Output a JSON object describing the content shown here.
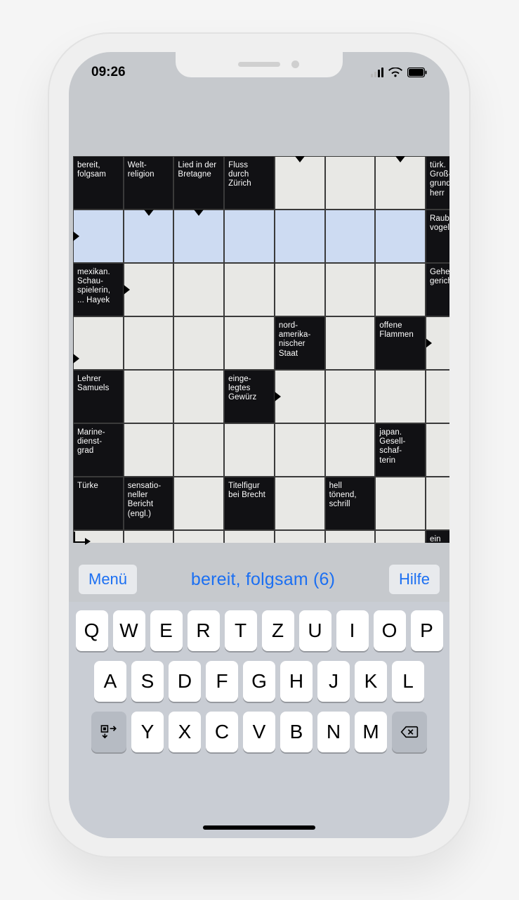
{
  "status": {
    "time": "09:26"
  },
  "cluebar": {
    "menu_label": "Menü",
    "help_label": "Hilfe",
    "current_clue": "bereit, folgsam (6)"
  },
  "grid": {
    "rows": [
      [
        {
          "t": "dark",
          "clue": "bereit, folgsam"
        },
        {
          "t": "dark",
          "clue": "Welt-\nreligion"
        },
        {
          "t": "dark",
          "clue": "Lied in der Bretagne"
        },
        {
          "t": "dark",
          "clue": "Fluss durch Zürich"
        },
        {
          "t": "light",
          "arrows": [
            "down"
          ]
        },
        {
          "t": "light"
        },
        {
          "t": "light",
          "arrows": [
            "down"
          ]
        },
        {
          "t": "dark",
          "clue": "türk. Groß-\ngrund-\nherr",
          "partial": true
        }
      ],
      [
        {
          "t": "hi",
          "arrows": [
            "right"
          ]
        },
        {
          "t": "hi",
          "arrows": [
            "down"
          ]
        },
        {
          "t": "hi",
          "arrows": [
            "down"
          ]
        },
        {
          "t": "hi"
        },
        {
          "t": "hi"
        },
        {
          "t": "hi"
        },
        {
          "t": "hi"
        },
        {
          "t": "dark",
          "clue": "Raub-\nvogel",
          "partial": true
        }
      ],
      [
        {
          "t": "dark",
          "clue": "mexikan. Schau-\nspielerin, ... Hayek"
        },
        {
          "t": "light",
          "arrows": [
            "right"
          ]
        },
        {
          "t": "light"
        },
        {
          "t": "light"
        },
        {
          "t": "light"
        },
        {
          "t": "light"
        },
        {
          "t": "light"
        },
        {
          "t": "dark",
          "clue": "Geheim-\ngericht",
          "partial": true
        }
      ],
      [
        {
          "t": "light",
          "arrows": [
            "right-low"
          ]
        },
        {
          "t": "light"
        },
        {
          "t": "light"
        },
        {
          "t": "light"
        },
        {
          "t": "dark",
          "clue": "nord-\namerika-\nnischer Staat"
        },
        {
          "t": "light"
        },
        {
          "t": "dark",
          "clue": "offene Flammen"
        },
        {
          "t": "light",
          "arrows": [
            "right"
          ],
          "partial": true
        }
      ],
      [
        {
          "t": "dark",
          "clue": "Lehrer Samuels"
        },
        {
          "t": "light"
        },
        {
          "t": "light"
        },
        {
          "t": "dark",
          "clue": "einge-\nlegtes Gewürz"
        },
        {
          "t": "light",
          "arrows": [
            "right"
          ]
        },
        {
          "t": "light"
        },
        {
          "t": "light"
        },
        {
          "t": "light",
          "partial": true
        }
      ],
      [
        {
          "t": "dark",
          "clue": "Marine-\ndienst-\ngrad"
        },
        {
          "t": "light"
        },
        {
          "t": "light"
        },
        {
          "t": "light"
        },
        {
          "t": "light"
        },
        {
          "t": "light"
        },
        {
          "t": "dark",
          "clue": "japan. Gesell-\nschaf-\nterin"
        },
        {
          "t": "light",
          "partial": true
        }
      ],
      [
        {
          "t": "dark",
          "clue": "Türke"
        },
        {
          "t": "dark",
          "clue": "sensatio-\nneller Bericht (engl.)"
        },
        {
          "t": "light"
        },
        {
          "t": "dark",
          "clue": "Titelfigur bei Brecht"
        },
        {
          "t": "light"
        },
        {
          "t": "dark",
          "clue": "hell tönend, schrill"
        },
        {
          "t": "light"
        },
        {
          "t": "light",
          "partial": true
        }
      ],
      [
        {
          "t": "light",
          "arrows": [
            "corner"
          ]
        },
        {
          "t": "light"
        },
        {
          "t": "light"
        },
        {
          "t": "light"
        },
        {
          "t": "light"
        },
        {
          "t": "light"
        },
        {
          "t": "light"
        },
        {
          "t": "dark",
          "clue": "ein dt.",
          "partial": true
        }
      ]
    ]
  },
  "keyboard": {
    "rows": [
      [
        "Q",
        "W",
        "E",
        "R",
        "T",
        "Z",
        "U",
        "I",
        "O",
        "P"
      ],
      [
        "A",
        "S",
        "D",
        "F",
        "G",
        "H",
        "J",
        "K",
        "L"
      ],
      [
        "Y",
        "X",
        "C",
        "V",
        "B",
        "N",
        "M"
      ]
    ]
  }
}
